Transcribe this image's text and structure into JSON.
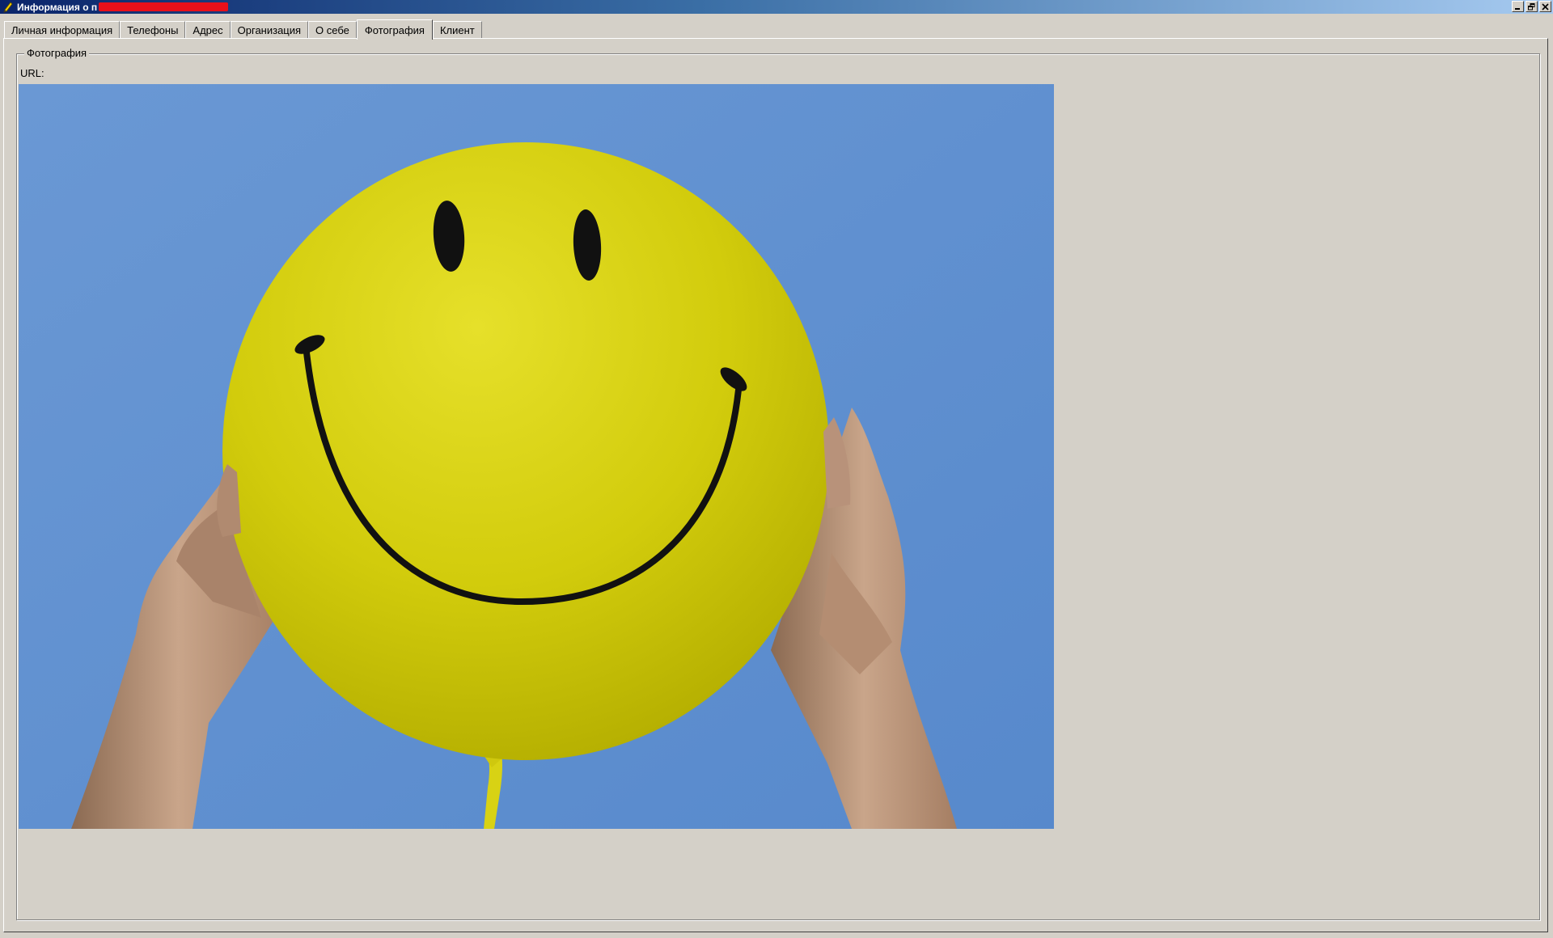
{
  "window": {
    "title": "Информация о п",
    "icon": "pen-icon"
  },
  "tabs": [
    {
      "label": "Личная информация",
      "active": false
    },
    {
      "label": "Телефоны",
      "active": false
    },
    {
      "label": "Адрес",
      "active": false
    },
    {
      "label": "Организация",
      "active": false
    },
    {
      "label": "О себе",
      "active": false
    },
    {
      "label": "Фотография",
      "active": true
    },
    {
      "label": "Клиент",
      "active": false
    }
  ],
  "photo_group": {
    "legend": "Фотография",
    "url_label": "URL:",
    "photo_description": "smiley-balloon-photo"
  },
  "colors": {
    "sky": "#5d8fd0",
    "balloon": "#d8d410",
    "chrome": "#d4d0c8",
    "title_start": "#0a246a"
  }
}
